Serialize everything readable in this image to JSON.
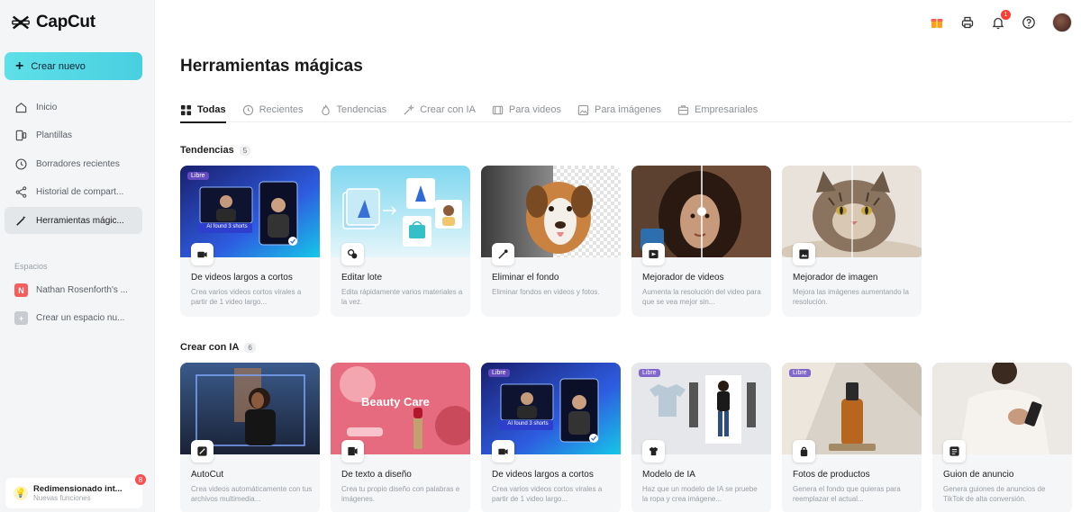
{
  "app": {
    "name": "CapCut"
  },
  "sidebar": {
    "create_label": "Crear nuevo",
    "items": [
      {
        "label": "Inicio",
        "icon": "home-icon"
      },
      {
        "label": "Plantillas",
        "icon": "templates-icon"
      },
      {
        "label": "Borradores recientes",
        "icon": "clock-icon"
      },
      {
        "label": "Historial de compart...",
        "icon": "share-icon"
      },
      {
        "label": "Herramientas mágic...",
        "icon": "magic-wand-icon"
      }
    ],
    "spaces_label": "Espacios",
    "spaces": [
      {
        "label": "Nathan Rosenforth's ...",
        "badge": "N",
        "color": "#f25f5c"
      },
      {
        "label": "Crear un espacio nu...",
        "badge": "+",
        "color": "#c8ccd0"
      }
    ],
    "promo": {
      "title": "Redimensionado int...",
      "subtitle": "Nuevas funciones",
      "count": "8"
    }
  },
  "topbar": {
    "notification_count": "1"
  },
  "main": {
    "title": "Herramientas mágicas",
    "tabs": [
      {
        "label": "Todas"
      },
      {
        "label": "Recientes"
      },
      {
        "label": "Tendencias"
      },
      {
        "label": "Crear con IA"
      },
      {
        "label": "Para videos"
      },
      {
        "label": "Para imágenes"
      },
      {
        "label": "Empresariales"
      }
    ],
    "sections": [
      {
        "title": "Tendencias",
        "count": "5",
        "cards": [
          {
            "title": "De videos largos a cortos",
            "desc": "Crea varios videos cortos virales a partir de 1 video largo...",
            "badge": "Libre",
            "overlay": "AI found 3 shorts"
          },
          {
            "title": "Editar lote",
            "desc": "Edita rápidamente varios materiales a la vez."
          },
          {
            "title": "Eliminar el fondo",
            "desc": "Eliminar fondos en videos y fotos."
          },
          {
            "title": "Mejorador de videos",
            "desc": "Aumenta la resolución del video para que se vea mejor sin..."
          },
          {
            "title": "Mejorador de imagen",
            "desc": "Mejora las imágenes aumentando la resolución."
          }
        ]
      },
      {
        "title": "Crear con IA",
        "count": "6",
        "cards": [
          {
            "title": "AutoCut",
            "desc": "Crea videos automáticamente con tus archivos multimedia..."
          },
          {
            "title": "De texto a diseño",
            "desc": "Crea tu propio diseño con palabras e imágenes.",
            "overlay": "Beauty Care"
          },
          {
            "title": "De videos largos a cortos",
            "desc": "Crea varios videos cortos virales a partir de 1 video largo...",
            "badge": "Libre",
            "overlay": "AI found 3 shorts"
          },
          {
            "title": "Modelo de IA",
            "desc": "Haz que un modelo de IA se pruebe la ropa y crea imágene...",
            "badge": "Libre"
          },
          {
            "title": "Fotos de productos",
            "desc": "Genera el fondo que quieras para reemplazar el actual...",
            "badge": "Libre"
          },
          {
            "title": "Guion de anuncio",
            "desc": "Genera guiones de anuncios de TikTok de alta conversión."
          }
        ]
      }
    ]
  }
}
